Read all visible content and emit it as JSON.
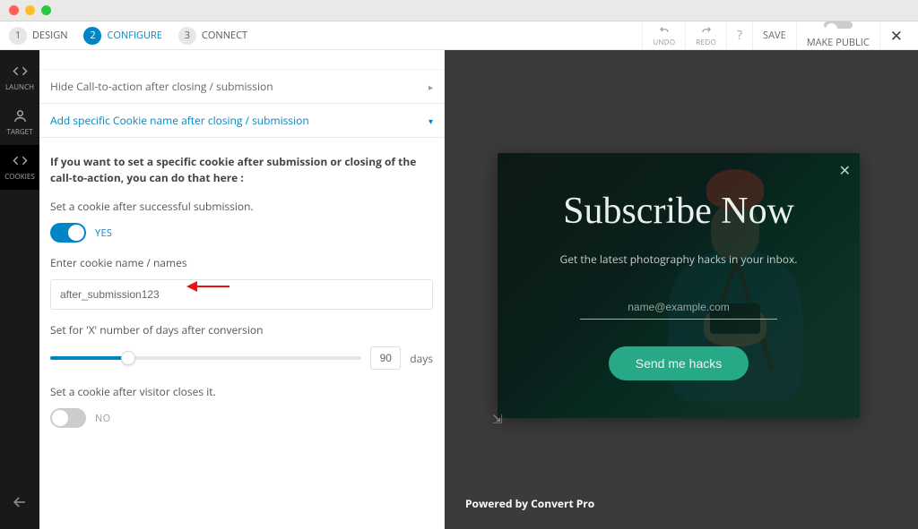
{
  "steps": [
    {
      "num": "1",
      "label": "DESIGN"
    },
    {
      "num": "2",
      "label": "CONFIGURE"
    },
    {
      "num": "3",
      "label": "CONNECT"
    }
  ],
  "topbar": {
    "undo": "UNDO",
    "redo": "REDO",
    "save": "SAVE",
    "make_public": "MAKE PUBLIC"
  },
  "sidebar": {
    "items": [
      {
        "label": "LAUNCH"
      },
      {
        "label": "TARGET"
      },
      {
        "label": "COOKIES"
      }
    ]
  },
  "panel": {
    "acc_hide": "Hide Call-to-action after closing / submission",
    "acc_cookie": "Add specific Cookie name after closing / submission",
    "desc": "If you want to set a specific cookie after submission or closing of the call-to-action, you can do that here :",
    "set_success": "Set a cookie after successful submission.",
    "yes": "YES",
    "enter_names": "Enter cookie name / names",
    "cookie_value": "after_submission123",
    "set_days": "Set for 'X' number of days after conversion",
    "days_value": "90",
    "days_label": "days",
    "set_close": "Set a cookie after visitor closes it.",
    "no": "NO"
  },
  "preview": {
    "title": "Subscribe Now",
    "subtitle": "Get the latest photography hacks in your inbox.",
    "placeholder": "name@example.com",
    "button": "Send me hacks",
    "powered": "Powered by Convert Pro"
  }
}
